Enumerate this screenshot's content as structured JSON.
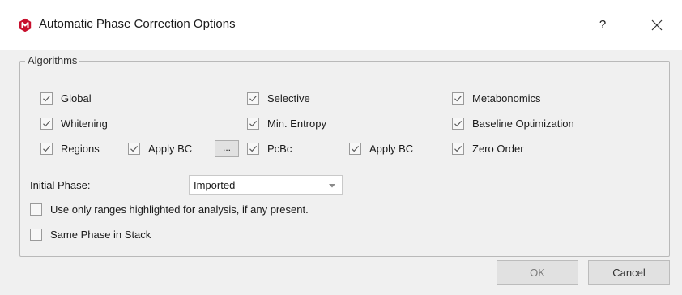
{
  "window": {
    "title": "Automatic Phase Correction Options",
    "help_label": "?",
    "app_icon": "mnova-app-icon",
    "accent_color": "#c8102e"
  },
  "algorithms": {
    "legend": "Algorithms",
    "global": {
      "label": "Global",
      "checked": true
    },
    "selective": {
      "label": "Selective",
      "checked": true
    },
    "metabonomics": {
      "label": "Metabonomics",
      "checked": true
    },
    "whitening": {
      "label": "Whitening",
      "checked": true
    },
    "min_entropy": {
      "label": "Min. Entropy",
      "checked": true
    },
    "baseline_optimization": {
      "label": "Baseline Optimization",
      "checked": true
    },
    "regions": {
      "label": "Regions",
      "checked": true
    },
    "regions_apply_bc": {
      "label": "Apply BC",
      "checked": true
    },
    "regions_more_label": "...",
    "pcbc": {
      "label": "PcBc",
      "checked": true
    },
    "pcbc_apply_bc": {
      "label": "Apply BC",
      "checked": true
    },
    "zero_order": {
      "label": "Zero Order",
      "checked": true
    }
  },
  "initial_phase": {
    "label": "Initial Phase:",
    "selected": "Imported"
  },
  "options": {
    "use_ranges": {
      "label": "Use only ranges highlighted for analysis, if any present.",
      "checked": false
    },
    "same_phase": {
      "label": "Same Phase in Stack",
      "checked": false
    }
  },
  "buttons": {
    "ok_label": "OK",
    "cancel_label": "Cancel"
  }
}
